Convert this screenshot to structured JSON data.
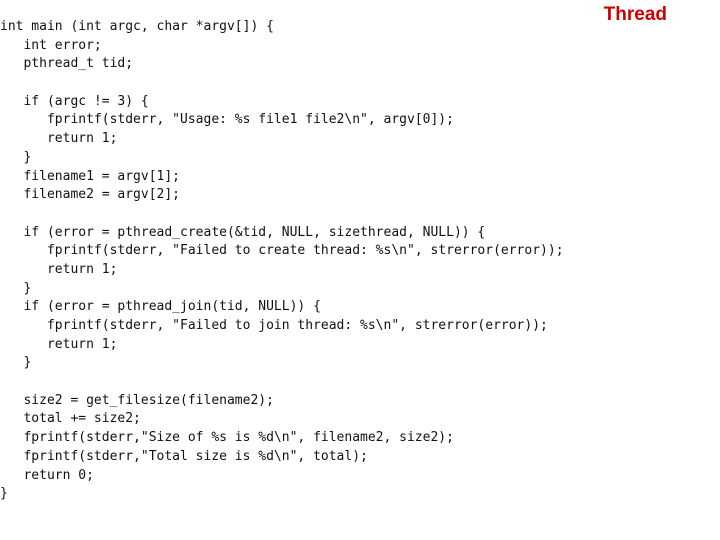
{
  "slide": {
    "title": "Thread",
    "title_color": "#cc0000"
  },
  "code": {
    "language": "c",
    "lines": [
      "int main (int argc, char *argv[]) {",
      "   int error;",
      "   pthread_t tid;",
      "",
      "   if (argc != 3) {",
      "      fprintf(stderr, \"Usage: %s file1 file2\\n\", argv[0]);",
      "      return 1;",
      "   }",
      "   filename1 = argv[1];",
      "   filename2 = argv[2];",
      "",
      "   if (error = pthread_create(&tid, NULL, sizethread, NULL)) {",
      "      fprintf(stderr, \"Failed to create thread: %s\\n\", strerror(error));",
      "      return 1;",
      "   }",
      "   if (error = pthread_join(tid, NULL)) {",
      "      fprintf(stderr, \"Failed to join thread: %s\\n\", strerror(error));",
      "      return 1;",
      "   }",
      "",
      "   size2 = get_filesize(filename2);",
      "   total += size2;",
      "   fprintf(stderr,\"Size of %s is %d\\n\", filename2, size2);",
      "   fprintf(stderr,\"Total size is %d\\n\", total);",
      "   return 0;",
      "}"
    ]
  }
}
